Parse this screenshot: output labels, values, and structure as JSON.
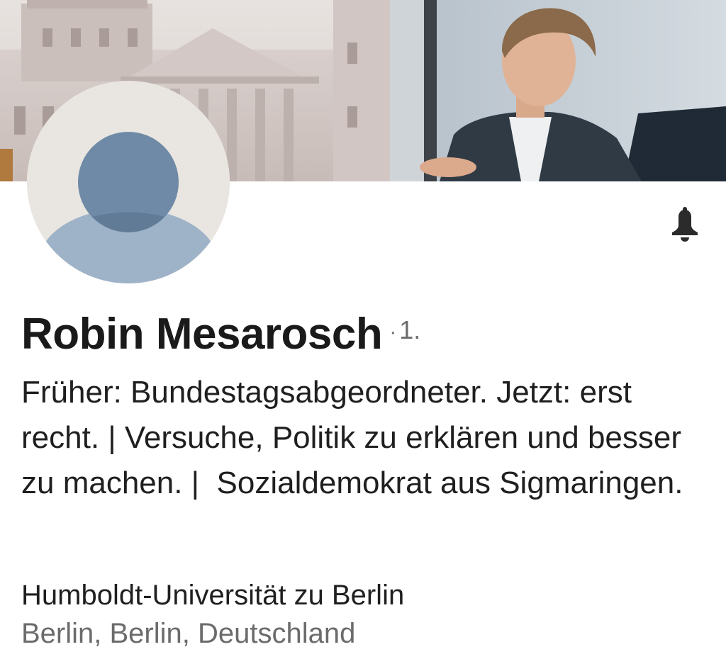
{
  "profile": {
    "name": "Robin Mesarosch",
    "degree_separator": "·",
    "connection_degree": "1.",
    "headline": "Früher: Bundestagsabgeordneter. Jetzt: erst recht. | Versuche, Politik zu erklären und besser zu machen. |  Sozialdemokrat aus Sigmaringen.",
    "education": "Humboldt-Universität zu Berlin",
    "location": "Berlin, Berlin, Deutschland"
  },
  "icons": {
    "notification": "bell-icon",
    "avatar": "default-person-icon"
  },
  "colors": {
    "text_primary": "#1a1a1a",
    "text_secondary": "#6b6b6b",
    "avatar_bg": "#e9e5e0",
    "avatar_head": "#6f8aa6",
    "avatar_body": "#9fb3c8"
  }
}
